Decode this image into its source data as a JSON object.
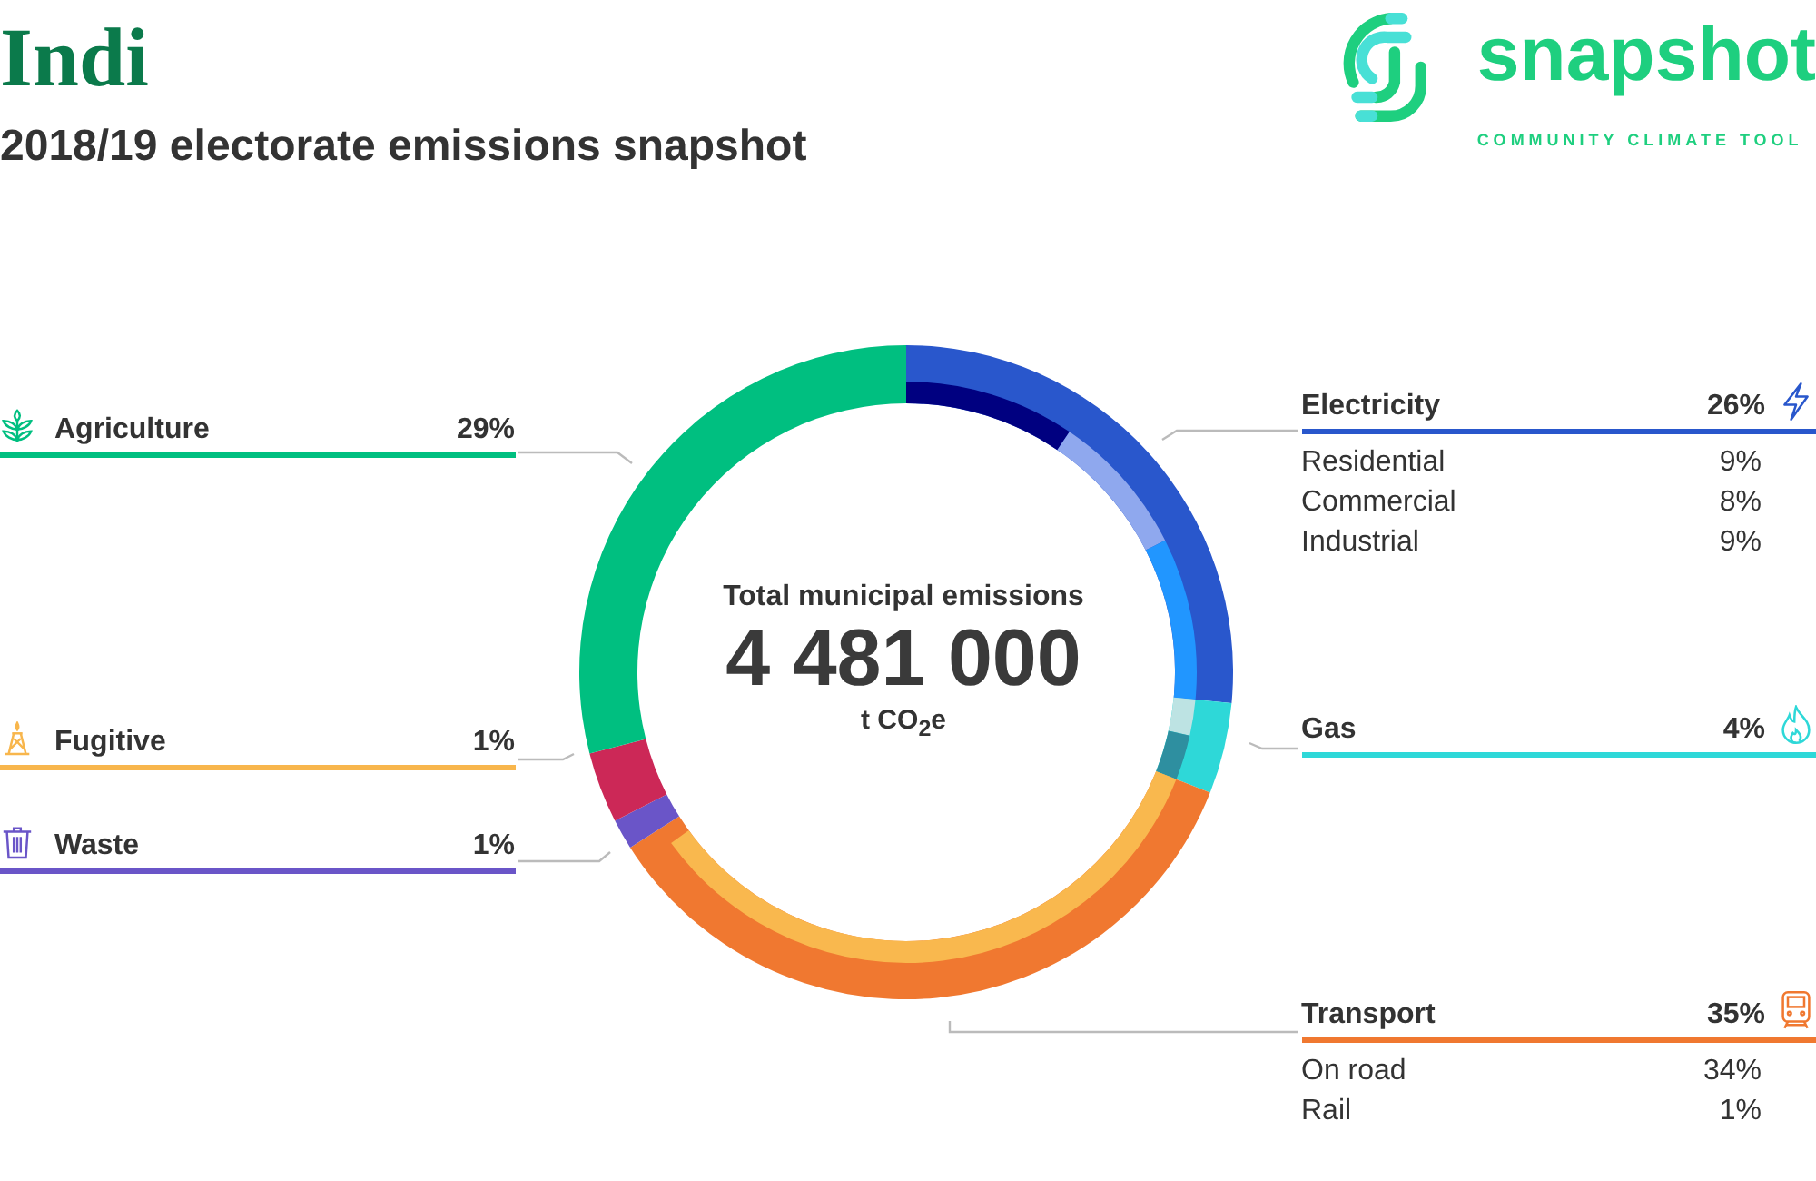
{
  "header": {
    "title": "Indi",
    "subtitle": "2018/19 electorate emissions snapshot"
  },
  "logo": {
    "name": "snapshot",
    "tagline": "COMMUNITY CLIMATE TOOL"
  },
  "center": {
    "label": "Total municipal emissions",
    "total": "4 481 000",
    "unit": "t CO$_{2}$e"
  },
  "sectors": [
    {
      "share": "29%",
      "color": "#00bf80",
      "kind": "agriculture"
    },
    {
      "share": "1%",
      "color": "#f8b64c",
      "kind": "fugitive"
    },
    {
      "share": "1%",
      "color": "#6a55c8",
      "kind": "waste"
    },
    {
      "share": "26%",
      "color": "#2957cc",
      "kind": "electricity",
      "subsectors": [
        {
          "name": "Residential",
          "share": "9%"
        },
        {
          "name": "Commercial",
          "share": "8%"
        },
        {
          "name": "Industrial",
          "share": "9%"
        }
      ]
    },
    {
      "share": "4%",
      "color": "#2ed8d8",
      "kind": "gas"
    },
    {
      "share": "35%",
      "color": "#f07830",
      "kind": "transport",
      "subsectors": [
        {
          "name": "On road",
          "share": "34%"
        },
        {
          "name": "Rail",
          "share": "1%"
        }
      ]
    }
  ],
  "chart_data": {
    "type": "donut",
    "categories": [
      "Agriculture",
      "Fugitive",
      "Waste",
      "Electricity",
      "Gas",
      "Transport"
    ],
    "values": [
      29,
      3.5,
      1.5,
      26.5,
      4.5,
      35
    ],
    "colors": [
      "#00bf80",
      "#cc2857",
      "#6a55c8",
      "#2957cc",
      "#2ed8d8",
      "#f07830"
    ]
  }
}
